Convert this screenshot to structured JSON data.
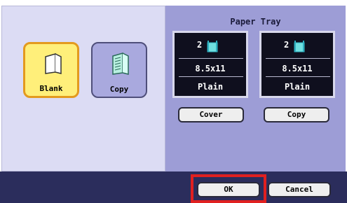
{
  "paper_tray": {
    "title": "Paper Tray",
    "trays": [
      {
        "number": "2",
        "size": "8.5x11",
        "type": "Plain",
        "button_label": "Cover"
      },
      {
        "number": "2",
        "size": "8.5x11",
        "type": "Plain",
        "button_label": "Copy"
      }
    ]
  },
  "options": {
    "blank_label": "Blank",
    "copy_label": "Copy"
  },
  "bottom_bar": {
    "ok_label": "OK",
    "cancel_label": "Cancel"
  },
  "colors": {
    "highlight": "#e02020",
    "selected_tile": "#ffef7a",
    "tray_panel": "#9d9dd6"
  }
}
